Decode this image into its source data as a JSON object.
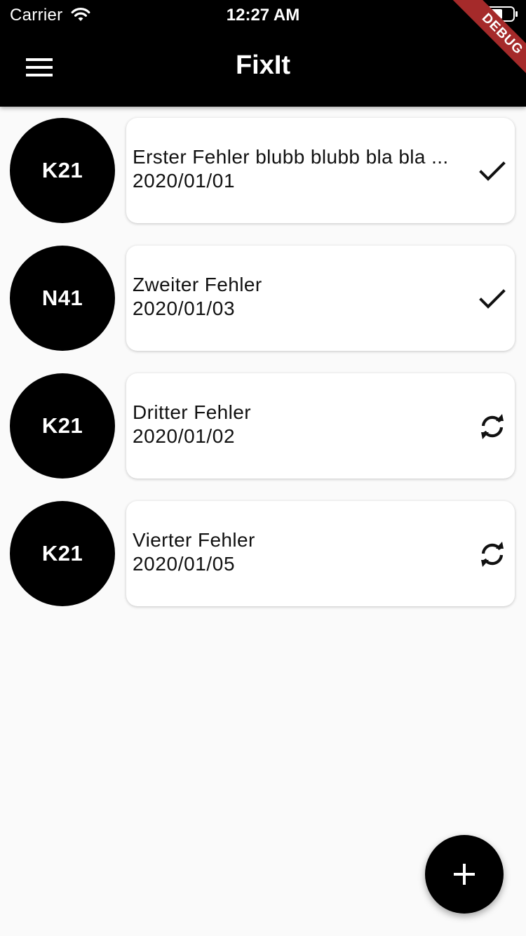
{
  "status_bar": {
    "carrier": "Carrier",
    "time": "12:27 AM",
    "wifi_icon": "wifi-icon",
    "battery_icon": "battery-icon"
  },
  "app_bar": {
    "title": "FixIt",
    "menu_icon": "hamburger-menu-icon",
    "debug_banner": "DEBUG"
  },
  "issues": [
    {
      "code": "K21",
      "title": "Erster Fehler blubb blubb bla bla ...",
      "date": "2020/01/01",
      "status_icon": "check-icon"
    },
    {
      "code": "N41",
      "title": "Zweiter Fehler",
      "date": "2020/01/03",
      "status_icon": "check-icon"
    },
    {
      "code": "K21",
      "title": "Dritter Fehler",
      "date": "2020/01/02",
      "status_icon": "sync-icon"
    },
    {
      "code": "K21",
      "title": "Vierter Fehler",
      "date": "2020/01/05",
      "status_icon": "sync-icon"
    }
  ],
  "fab": {
    "icon": "add-icon"
  },
  "colors": {
    "app_bar": "#000000",
    "background": "#fafafa",
    "card": "#ffffff",
    "avatar": "#000000",
    "debug_banner": "#a52a2a"
  }
}
